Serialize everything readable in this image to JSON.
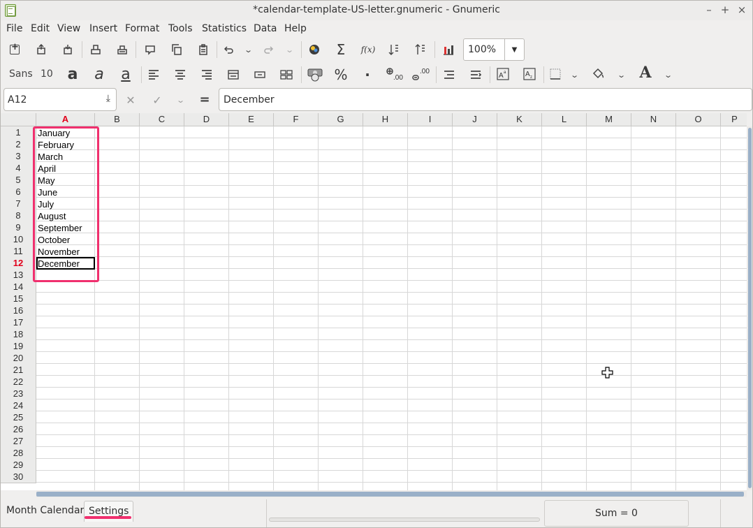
{
  "window": {
    "title": "*calendar-template-US-letter.gnumeric - Gnumeric",
    "minimize_glyph": "–",
    "maximize_glyph": "+",
    "close_glyph": "×"
  },
  "menu": [
    "File",
    "Edit",
    "View",
    "Insert",
    "Format",
    "Tools",
    "Statistics",
    "Data",
    "Help"
  ],
  "toolbar1": {
    "icons": [
      "new-icon",
      "open-icon",
      "save-icon",
      "print-icon",
      "print-preview-icon",
      "cut-icon",
      "copy-icon",
      "paste-icon",
      "undo-icon",
      "undo-dropdown-icon",
      "redo-icon",
      "redo-dropdown-icon",
      "insert-object-icon",
      "autosum-icon",
      "function-icon",
      "sort-ascending-icon",
      "sort-descending-icon",
      "chart-icon"
    ],
    "zoom": "100%"
  },
  "toolbar2": {
    "font_name": "Sans",
    "font_size": "10",
    "glyphs": {
      "bold": "a",
      "italic": "a",
      "underline": "a",
      "percent": "%",
      "thousands": "·",
      "font_color": "A"
    }
  },
  "formula_bar": {
    "cell_ref": "A12",
    "cancel_glyph": "✕",
    "accept_glyph": "✓",
    "equals_glyph": "=",
    "value": "December"
  },
  "sheet": {
    "columns": [
      "A",
      "B",
      "C",
      "D",
      "E",
      "F",
      "G",
      "H",
      "I",
      "J",
      "K",
      "L",
      "M",
      "N",
      "O",
      "P"
    ],
    "active_column": "A",
    "rows": [
      "1",
      "2",
      "3",
      "4",
      "5",
      "6",
      "7",
      "8",
      "9",
      "10",
      "11",
      "12",
      "13",
      "14",
      "15",
      "16",
      "17",
      "18",
      "19",
      "20",
      "21",
      "22",
      "23",
      "24",
      "25",
      "26",
      "27",
      "28",
      "29",
      "30"
    ],
    "active_row": "12",
    "column_a_values": [
      "January",
      "February",
      "March",
      "April",
      "May",
      "June",
      "July",
      "August",
      "September",
      "October",
      "November",
      "December"
    ]
  },
  "tabs": [
    "Month Calendar",
    "Settings"
  ],
  "active_tab": "Settings",
  "status": {
    "sum": "Sum = 0"
  },
  "colors": {
    "highlight": "#f0306e",
    "active_header": "#e0001b",
    "scroll_thumb": "#9ab0c8"
  }
}
